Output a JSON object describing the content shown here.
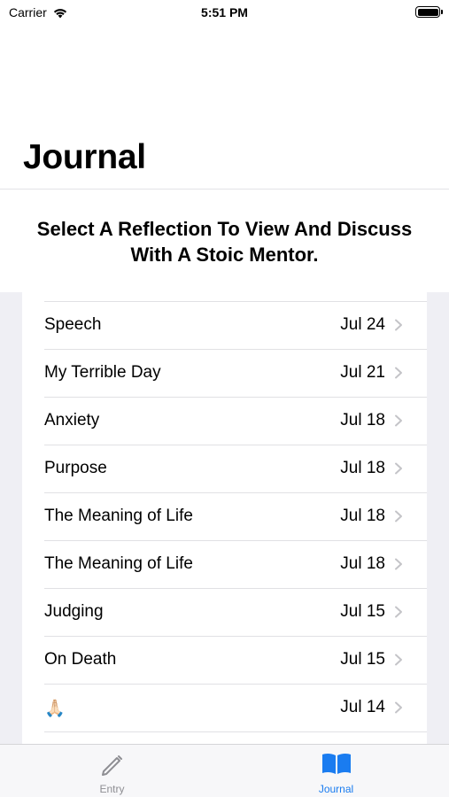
{
  "status_bar": {
    "carrier": "Carrier",
    "time": "5:51 PM"
  },
  "title": "Journal",
  "header": "Select A Reflection To View And Discuss With A Stoic Mentor.",
  "entries": [
    {
      "title": "Speech",
      "date": "Jul 24"
    },
    {
      "title": "My Terrible Day",
      "date": "Jul 21"
    },
    {
      "title": "Anxiety",
      "date": "Jul 18"
    },
    {
      "title": "Purpose",
      "date": "Jul 18"
    },
    {
      "title": "The Meaning of Life",
      "date": "Jul 18"
    },
    {
      "title": "The Meaning of Life",
      "date": "Jul 18"
    },
    {
      "title": "Judging",
      "date": "Jul 15"
    },
    {
      "title": "On Death",
      "date": "Jul 15"
    },
    {
      "title": "🙏🏻",
      "date": "Jul 14"
    }
  ],
  "tab_bar": {
    "tabs": [
      {
        "label": "Entry",
        "icon": "pencil-icon",
        "selected": false
      },
      {
        "label": "Journal",
        "icon": "book-icon",
        "selected": true
      }
    ]
  },
  "colors": {
    "accent": "#1a7cf0",
    "list_background": "#efeff4",
    "inactive_tab": "#8e8e93"
  }
}
